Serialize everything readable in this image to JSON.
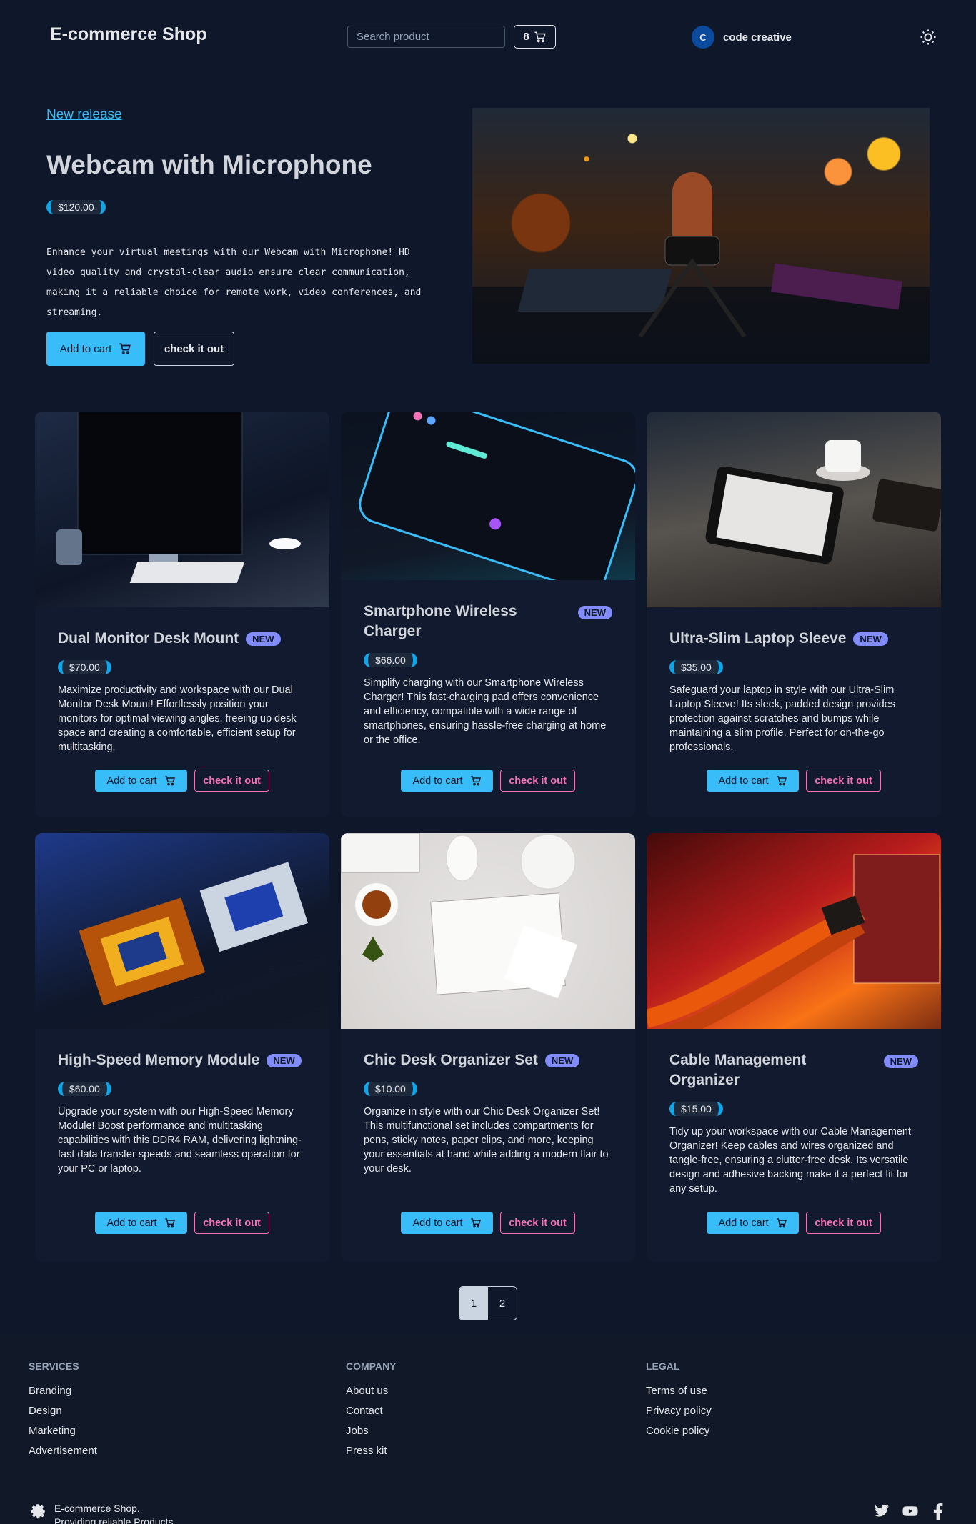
{
  "header": {
    "brand": "E-commerce Shop",
    "search_placeholder": "Search product",
    "cart_count": "8",
    "user_initial": "C",
    "user_name": "code creative"
  },
  "hero": {
    "link": "New release",
    "title": "Webcam with Microphone",
    "price": "$120.00",
    "description": "Enhance your virtual meetings with our Webcam with Microphone! HD video quality and crystal-clear audio ensure clear communication, making it a reliable choice for remote work, video conferences, and streaming.",
    "add_label": "Add to cart",
    "check_label": "check it out"
  },
  "products": [
    {
      "title": "Dual Monitor Desk Mount",
      "badge": "NEW",
      "price": "$70.00",
      "description": "Maximize productivity and workspace with our Dual Monitor Desk Mount! Effortlessly position your monitors for optimal viewing angles, freeing up desk space and creating a comfortable, efficient setup for multitasking.",
      "add_label": "Add to cart",
      "check_label": "check it out"
    },
    {
      "title": "Smartphone Wireless Charger",
      "badge": "NEW",
      "price": "$66.00",
      "description": "Simplify charging with our Smartphone Wireless Charger! This fast-charging pad offers convenience and efficiency, compatible with a wide range of smartphones, ensuring hassle-free charging at home or the office.",
      "add_label": "Add to cart",
      "check_label": "check it out"
    },
    {
      "title": "Ultra-Slim Laptop Sleeve",
      "badge": "NEW",
      "price": "$35.00",
      "description": "Safeguard your laptop in style with our Ultra-Slim Laptop Sleeve! Its sleek, padded design provides protection against scratches and bumps while maintaining a slim profile. Perfect for on-the-go professionals.",
      "add_label": "Add to cart",
      "check_label": "check it out"
    },
    {
      "title": "High-Speed Memory Module",
      "badge": "NEW",
      "price": "$60.00",
      "description": "Upgrade your system with our High-Speed Memory Module! Boost performance and multitasking capabilities with this DDR4 RAM, delivering lightning-fast data transfer speeds and seamless operation for your PC or laptop.",
      "add_label": "Add to cart",
      "check_label": "check it out"
    },
    {
      "title": "Chic Desk Organizer Set",
      "badge": "NEW",
      "price": "$10.00",
      "description": "Organize in style with our Chic Desk Organizer Set! This multifunctional set includes compartments for pens, sticky notes, paper clips, and more, keeping your essentials at hand while adding a modern flair to your desk.",
      "add_label": "Add to cart",
      "check_label": "check it out"
    },
    {
      "title": "Cable Management Organizer",
      "badge": "NEW",
      "price": "$15.00",
      "description": "Tidy up your workspace with our Cable Management Organizer! Keep cables and wires organized and tangle-free, ensuring a clutter-free desk. Its versatile design and adhesive backing make it a perfect fit for any setup.",
      "add_label": "Add to cart",
      "check_label": "check it out"
    }
  ],
  "pagination": {
    "pages": [
      "1",
      "2"
    ],
    "current": "1"
  },
  "footer": {
    "services": {
      "heading": "SERVICES",
      "links": [
        "Branding",
        "Design",
        "Marketing",
        "Advertisement"
      ]
    },
    "company": {
      "heading": "COMPANY",
      "links": [
        "About us",
        "Contact",
        "Jobs",
        "Press kit"
      ]
    },
    "legal": {
      "heading": "LEGAL",
      "links": [
        "Terms of use",
        "Privacy policy",
        "Cookie policy"
      ]
    },
    "brand_line1": "E-commerce Shop.",
    "brand_line2": "Providing reliable Products"
  },
  "icons": {
    "cart": "cart-icon",
    "theme": "sun-icon",
    "footer_logo": "gear-icon",
    "social": [
      "twitter-icon",
      "youtube-icon",
      "facebook-icon"
    ]
  },
  "colors": {
    "background": "#0f172a",
    "accent": "#38bdf8",
    "badge": "#818cf8",
    "check_button": "#f472b6"
  }
}
